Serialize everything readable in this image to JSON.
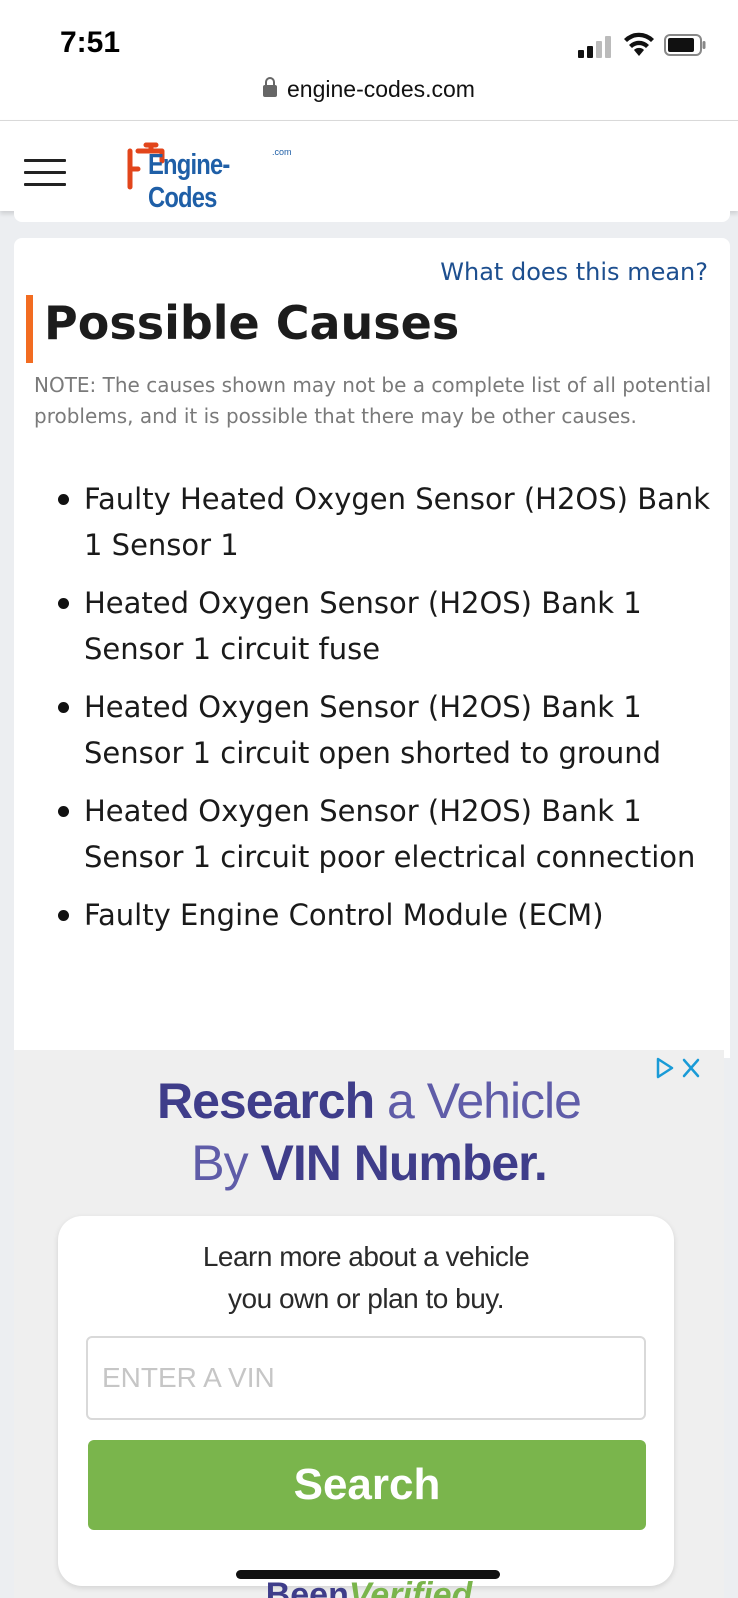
{
  "status_bar": {
    "time": "7:51"
  },
  "browser": {
    "url": "engine-codes.com"
  },
  "site": {
    "logo_text": "Engine-Codes",
    "logo_suffix": ".com"
  },
  "section": {
    "help_link": "What does this mean?",
    "title": "Possible Causes",
    "note": "NOTE: The causes shown may not be a complete list of all potential problems, and it is possible that there may be other causes.",
    "causes": [
      "Faulty Heated Oxygen Sensor (H2OS) Bank 1 Sensor 1",
      "Heated Oxygen Sensor (H2OS) Bank 1 Sensor 1 circuit fuse",
      "Heated Oxygen Sensor (H2OS) Bank 1 Sensor 1 circuit open shorted to ground",
      "Heated Oxygen Sensor (H2OS) Bank 1 Sensor 1 circuit poor electrical connection",
      "Faulty Engine Control Module (ECM)"
    ]
  },
  "ad": {
    "headline_bold_1": "Research",
    "headline_light_1": " a Vehicle",
    "headline_light_2": "By ",
    "headline_bold_2": "VIN Number.",
    "subtext_line1": "Learn more about a vehicle",
    "subtext_line2": "you own or plan to buy.",
    "vin_placeholder": "ENTER A VIN",
    "search_label": "Search",
    "brand_part1": "Been",
    "brand_part2": "Verified"
  },
  "colors": {
    "accent_orange": "#f26c21",
    "link_blue": "#1d4f8f",
    "ad_purple": "#3f3d8a",
    "ad_green": "#7ab54c"
  }
}
